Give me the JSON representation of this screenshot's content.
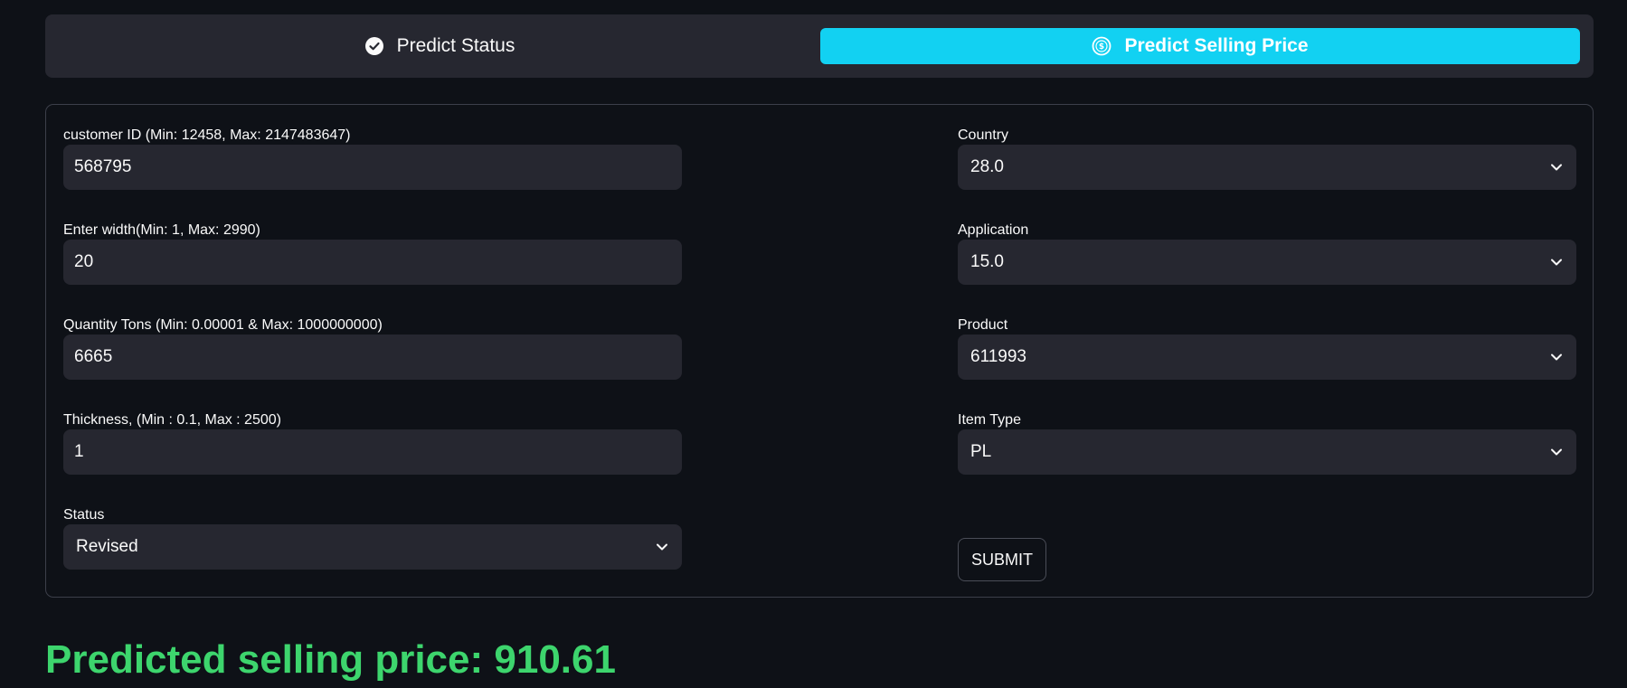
{
  "tabs": {
    "status_label": "Predict Status",
    "price_label": "Predict Selling Price"
  },
  "left_fields": [
    {
      "label": "customer ID (Min: 12458, Max: 2147483647)",
      "value": "568795"
    },
    {
      "label": "Enter width(Min: 1, Max: 2990)",
      "value": "20"
    },
    {
      "label": "Quantity Tons (Min: 0.00001 & Max: 1000000000)",
      "value": "6665"
    },
    {
      "label": "Thickness, (Min : 0.1, Max : 2500)",
      "value": "1"
    }
  ],
  "status_field": {
    "label": "Status",
    "value": "Revised"
  },
  "right_fields": [
    {
      "label": "Country",
      "value": "28.0"
    },
    {
      "label": "Application",
      "value": "15.0"
    },
    {
      "label": "Product",
      "value": "611993"
    },
    {
      "label": "Item Type",
      "value": "PL"
    }
  ],
  "submit_label": "SUBMIT",
  "result_text": "Predicted selling price: 910.61",
  "colors": {
    "background": "#0e1117",
    "panel": "#262730",
    "accent": "#12d1f2",
    "result": "#3dd56d"
  },
  "icons": {
    "status_tab": "check-circle-icon",
    "price_tab": "dollar-circle-icon",
    "dropdown": "chevron-down-icon"
  }
}
